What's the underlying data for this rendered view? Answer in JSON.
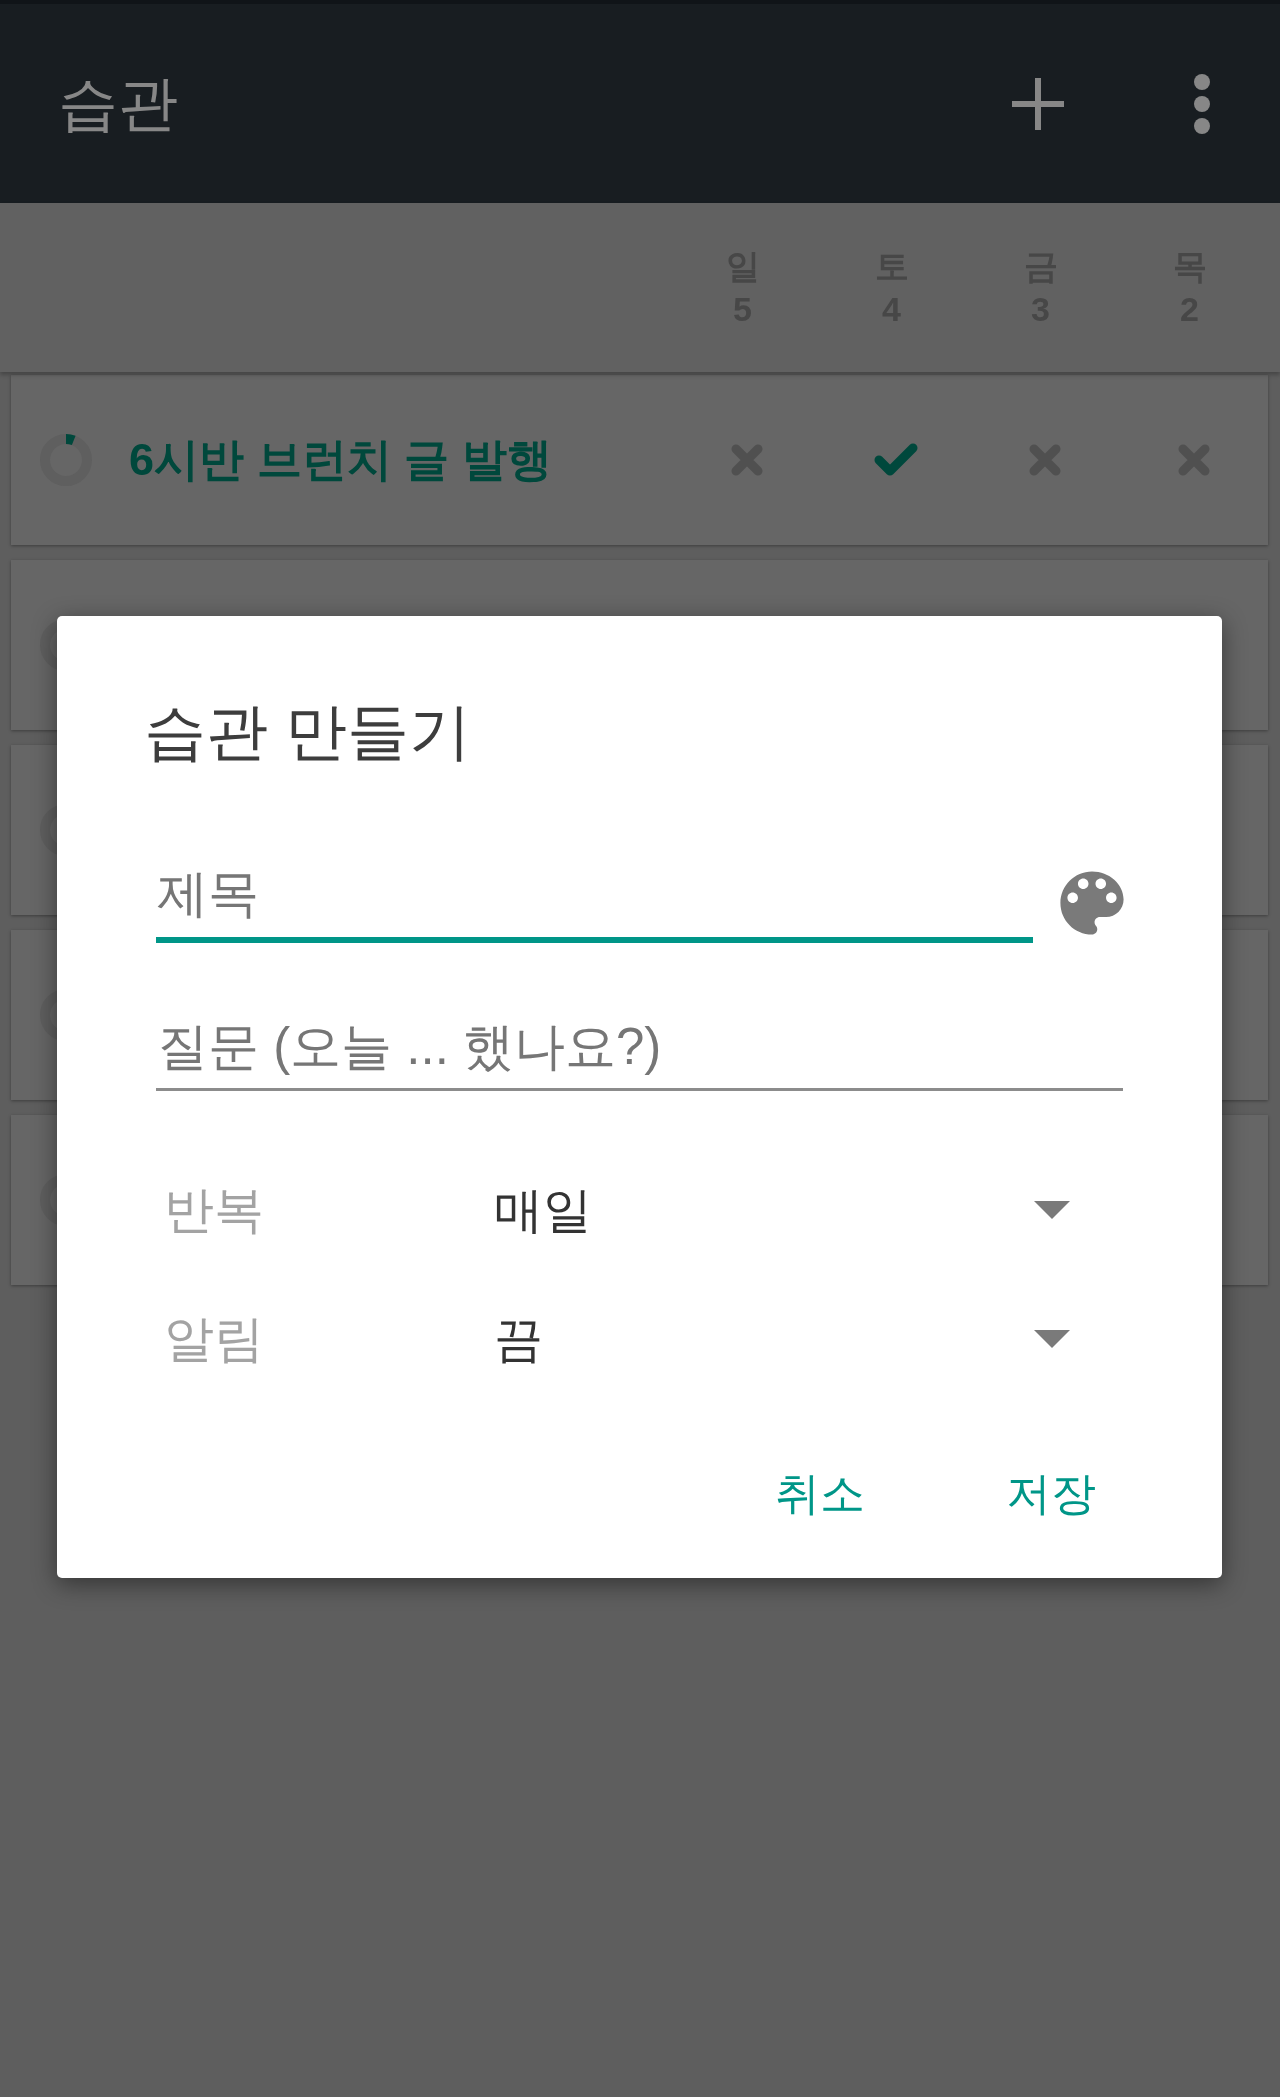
{
  "app_bar": {
    "title": "습관"
  },
  "day_columns": [
    {
      "day": "일",
      "date": "5"
    },
    {
      "day": "토",
      "date": "4"
    },
    {
      "day": "금",
      "date": "3"
    },
    {
      "day": "목",
      "date": "2"
    }
  ],
  "habits": [
    {
      "kind": "habit",
      "name": "6시반 브런치 글 발행",
      "color": "#00483c",
      "checks": [
        {
          "checked": false
        },
        {
          "checked": true
        },
        {
          "checked": false
        },
        {
          "checked": false
        }
      ]
    },
    {
      "kind": "covered"
    },
    {
      "kind": "covered"
    },
    {
      "kind": "covered"
    },
    {
      "kind": "covered"
    }
  ],
  "dialog": {
    "title": "습관 만들기",
    "fields": [
      {
        "placeholder": "제목",
        "focused": true
      },
      {
        "placeholder": "질문 (오늘 ... 했나요?)",
        "focused": false
      }
    ],
    "settings": [
      {
        "label": "반복",
        "value": "매일"
      },
      {
        "label": "알림",
        "value": "끔"
      }
    ],
    "buttons": [
      {
        "label": "취소"
      },
      {
        "label": "저장"
      }
    ]
  }
}
